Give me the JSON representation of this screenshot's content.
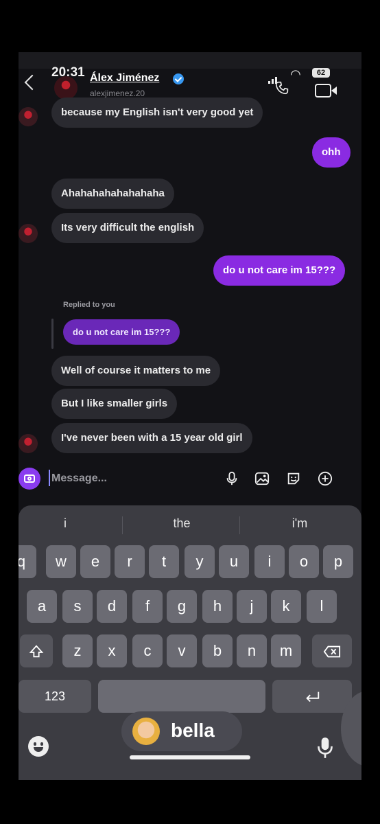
{
  "status_bar": {
    "time": "20:31",
    "battery": "62"
  },
  "header": {
    "contact_name": "Álex Jiménez",
    "contact_handle": "alexjimenez.20",
    "icons": [
      "back-chevron-icon",
      "verified-badge-icon",
      "phone-call-icon",
      "video-call-icon"
    ]
  },
  "messages": [
    {
      "direction": "in",
      "text": "because my English isn't very good yet"
    },
    {
      "direction": "out",
      "text": "ohh"
    },
    {
      "direction": "in",
      "text": "Ahahahahahahahaha"
    },
    {
      "direction": "in",
      "text": "Its very difficult the english"
    },
    {
      "direction": "out",
      "text": "do u not care im 15???"
    },
    {
      "direction": "in",
      "text": "Well of course it matters to me"
    },
    {
      "direction": "in",
      "text": "But I like smaller girls"
    },
    {
      "direction": "in",
      "text": "I've never been with a 15 year old girl"
    }
  ],
  "reply": {
    "label": "Replied to you",
    "quoted": "do u not care im 15???"
  },
  "composer": {
    "placeholder": "Message...",
    "icons": [
      "camera-icon",
      "microphone-icon",
      "gallery-icon",
      "sticker-icon",
      "add-icon"
    ]
  },
  "keyboard": {
    "suggestions": [
      "i",
      "the",
      "i'm"
    ],
    "row1": [
      "q",
      "w",
      "e",
      "r",
      "t",
      "y",
      "u",
      "i",
      "o",
      "p"
    ],
    "row2": [
      "a",
      "s",
      "d",
      "f",
      "g",
      "h",
      "j",
      "k",
      "l"
    ],
    "row3": [
      "z",
      "x",
      "c",
      "v",
      "b",
      "n",
      "m"
    ],
    "numbers_key": "123",
    "bitmoji_name": "bella",
    "accent_color": "#8a2be2"
  }
}
